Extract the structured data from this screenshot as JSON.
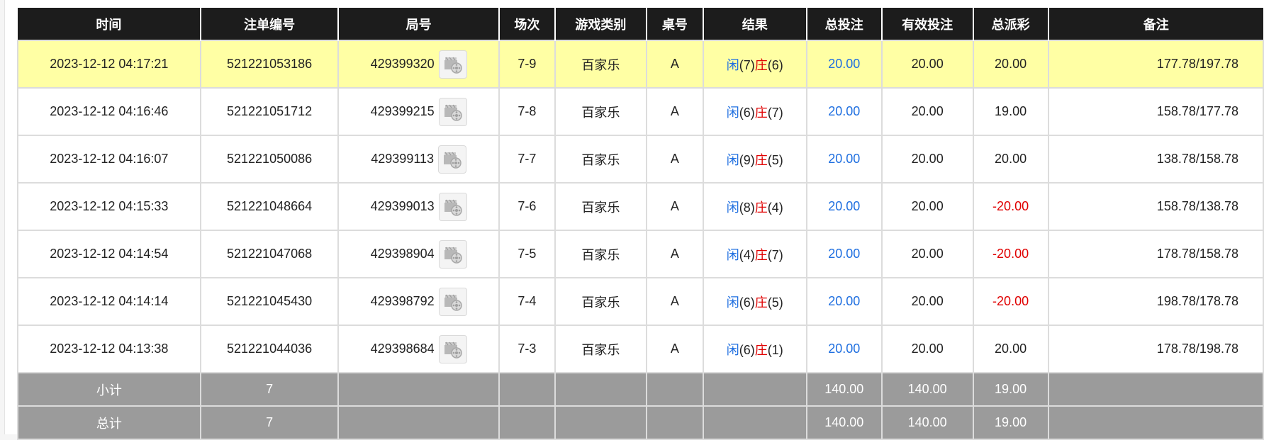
{
  "headers": [
    "时间",
    "注单编号",
    "局号",
    "场次",
    "游戏类别",
    "桌号",
    "结果",
    "总投注",
    "有效投注",
    "总派彩",
    "备注"
  ],
  "rows": [
    {
      "time": "2023-12-12 04:17:21",
      "bet_id": "521221053186",
      "round": "429399320",
      "session": "7-9",
      "game": "百家乐",
      "table": "A",
      "player_label": "闲",
      "player_score": "(7)",
      "banker_label": "庄",
      "banker_score": "(6)",
      "total_bet": "20.00",
      "valid_bet": "20.00",
      "payout": "20.00",
      "payout_negative": false,
      "note": "177.78/197.78",
      "highlighted": true
    },
    {
      "time": "2023-12-12 04:16:46",
      "bet_id": "521221051712",
      "round": "429399215",
      "session": "7-8",
      "game": "百家乐",
      "table": "A",
      "player_label": "闲",
      "player_score": "(6)",
      "banker_label": "庄",
      "banker_score": "(7)",
      "total_bet": "20.00",
      "valid_bet": "20.00",
      "payout": "19.00",
      "payout_negative": false,
      "note": "158.78/177.78",
      "highlighted": false
    },
    {
      "time": "2023-12-12 04:16:07",
      "bet_id": "521221050086",
      "round": "429399113",
      "session": "7-7",
      "game": "百家乐",
      "table": "A",
      "player_label": "闲",
      "player_score": "(9)",
      "banker_label": "庄",
      "banker_score": "(5)",
      "total_bet": "20.00",
      "valid_bet": "20.00",
      "payout": "20.00",
      "payout_negative": false,
      "note": "138.78/158.78",
      "highlighted": false
    },
    {
      "time": "2023-12-12 04:15:33",
      "bet_id": "521221048664",
      "round": "429399013",
      "session": "7-6",
      "game": "百家乐",
      "table": "A",
      "player_label": "闲",
      "player_score": "(8)",
      "banker_label": "庄",
      "banker_score": "(4)",
      "total_bet": "20.00",
      "valid_bet": "20.00",
      "payout": "-20.00",
      "payout_negative": true,
      "note": "158.78/138.78",
      "highlighted": false
    },
    {
      "time": "2023-12-12 04:14:54",
      "bet_id": "521221047068",
      "round": "429398904",
      "session": "7-5",
      "game": "百家乐",
      "table": "A",
      "player_label": "闲",
      "player_score": "(4)",
      "banker_label": "庄",
      "banker_score": "(7)",
      "total_bet": "20.00",
      "valid_bet": "20.00",
      "payout": "-20.00",
      "payout_negative": true,
      "note": "178.78/158.78",
      "highlighted": false
    },
    {
      "time": "2023-12-12 04:14:14",
      "bet_id": "521221045430",
      "round": "429398792",
      "session": "7-4",
      "game": "百家乐",
      "table": "A",
      "player_label": "闲",
      "player_score": "(6)",
      "banker_label": "庄",
      "banker_score": "(5)",
      "total_bet": "20.00",
      "valid_bet": "20.00",
      "payout": "-20.00",
      "payout_negative": true,
      "note": "198.78/178.78",
      "highlighted": false
    },
    {
      "time": "2023-12-12 04:13:38",
      "bet_id": "521221044036",
      "round": "429398684",
      "session": "7-3",
      "game": "百家乐",
      "table": "A",
      "player_label": "闲",
      "player_score": "(6)",
      "banker_label": "庄",
      "banker_score": "(1)",
      "total_bet": "20.00",
      "valid_bet": "20.00",
      "payout": "20.00",
      "payout_negative": false,
      "note": "178.78/198.78",
      "highlighted": false
    }
  ],
  "subtotal": {
    "label": "小计",
    "count": "7",
    "total_bet": "140.00",
    "valid_bet": "140.00",
    "payout": "19.00"
  },
  "total": {
    "label": "总计",
    "count": "7",
    "total_bet": "140.00",
    "valid_bet": "140.00",
    "payout": "19.00"
  },
  "colors": {
    "header_bg": "#1c1c1c",
    "highlight": "#ffffa4",
    "blue": "#1f6fe0",
    "red": "#e00000",
    "summary_bg": "#9b9b9b"
  },
  "icons": {
    "replay": "video-replay-icon"
  }
}
